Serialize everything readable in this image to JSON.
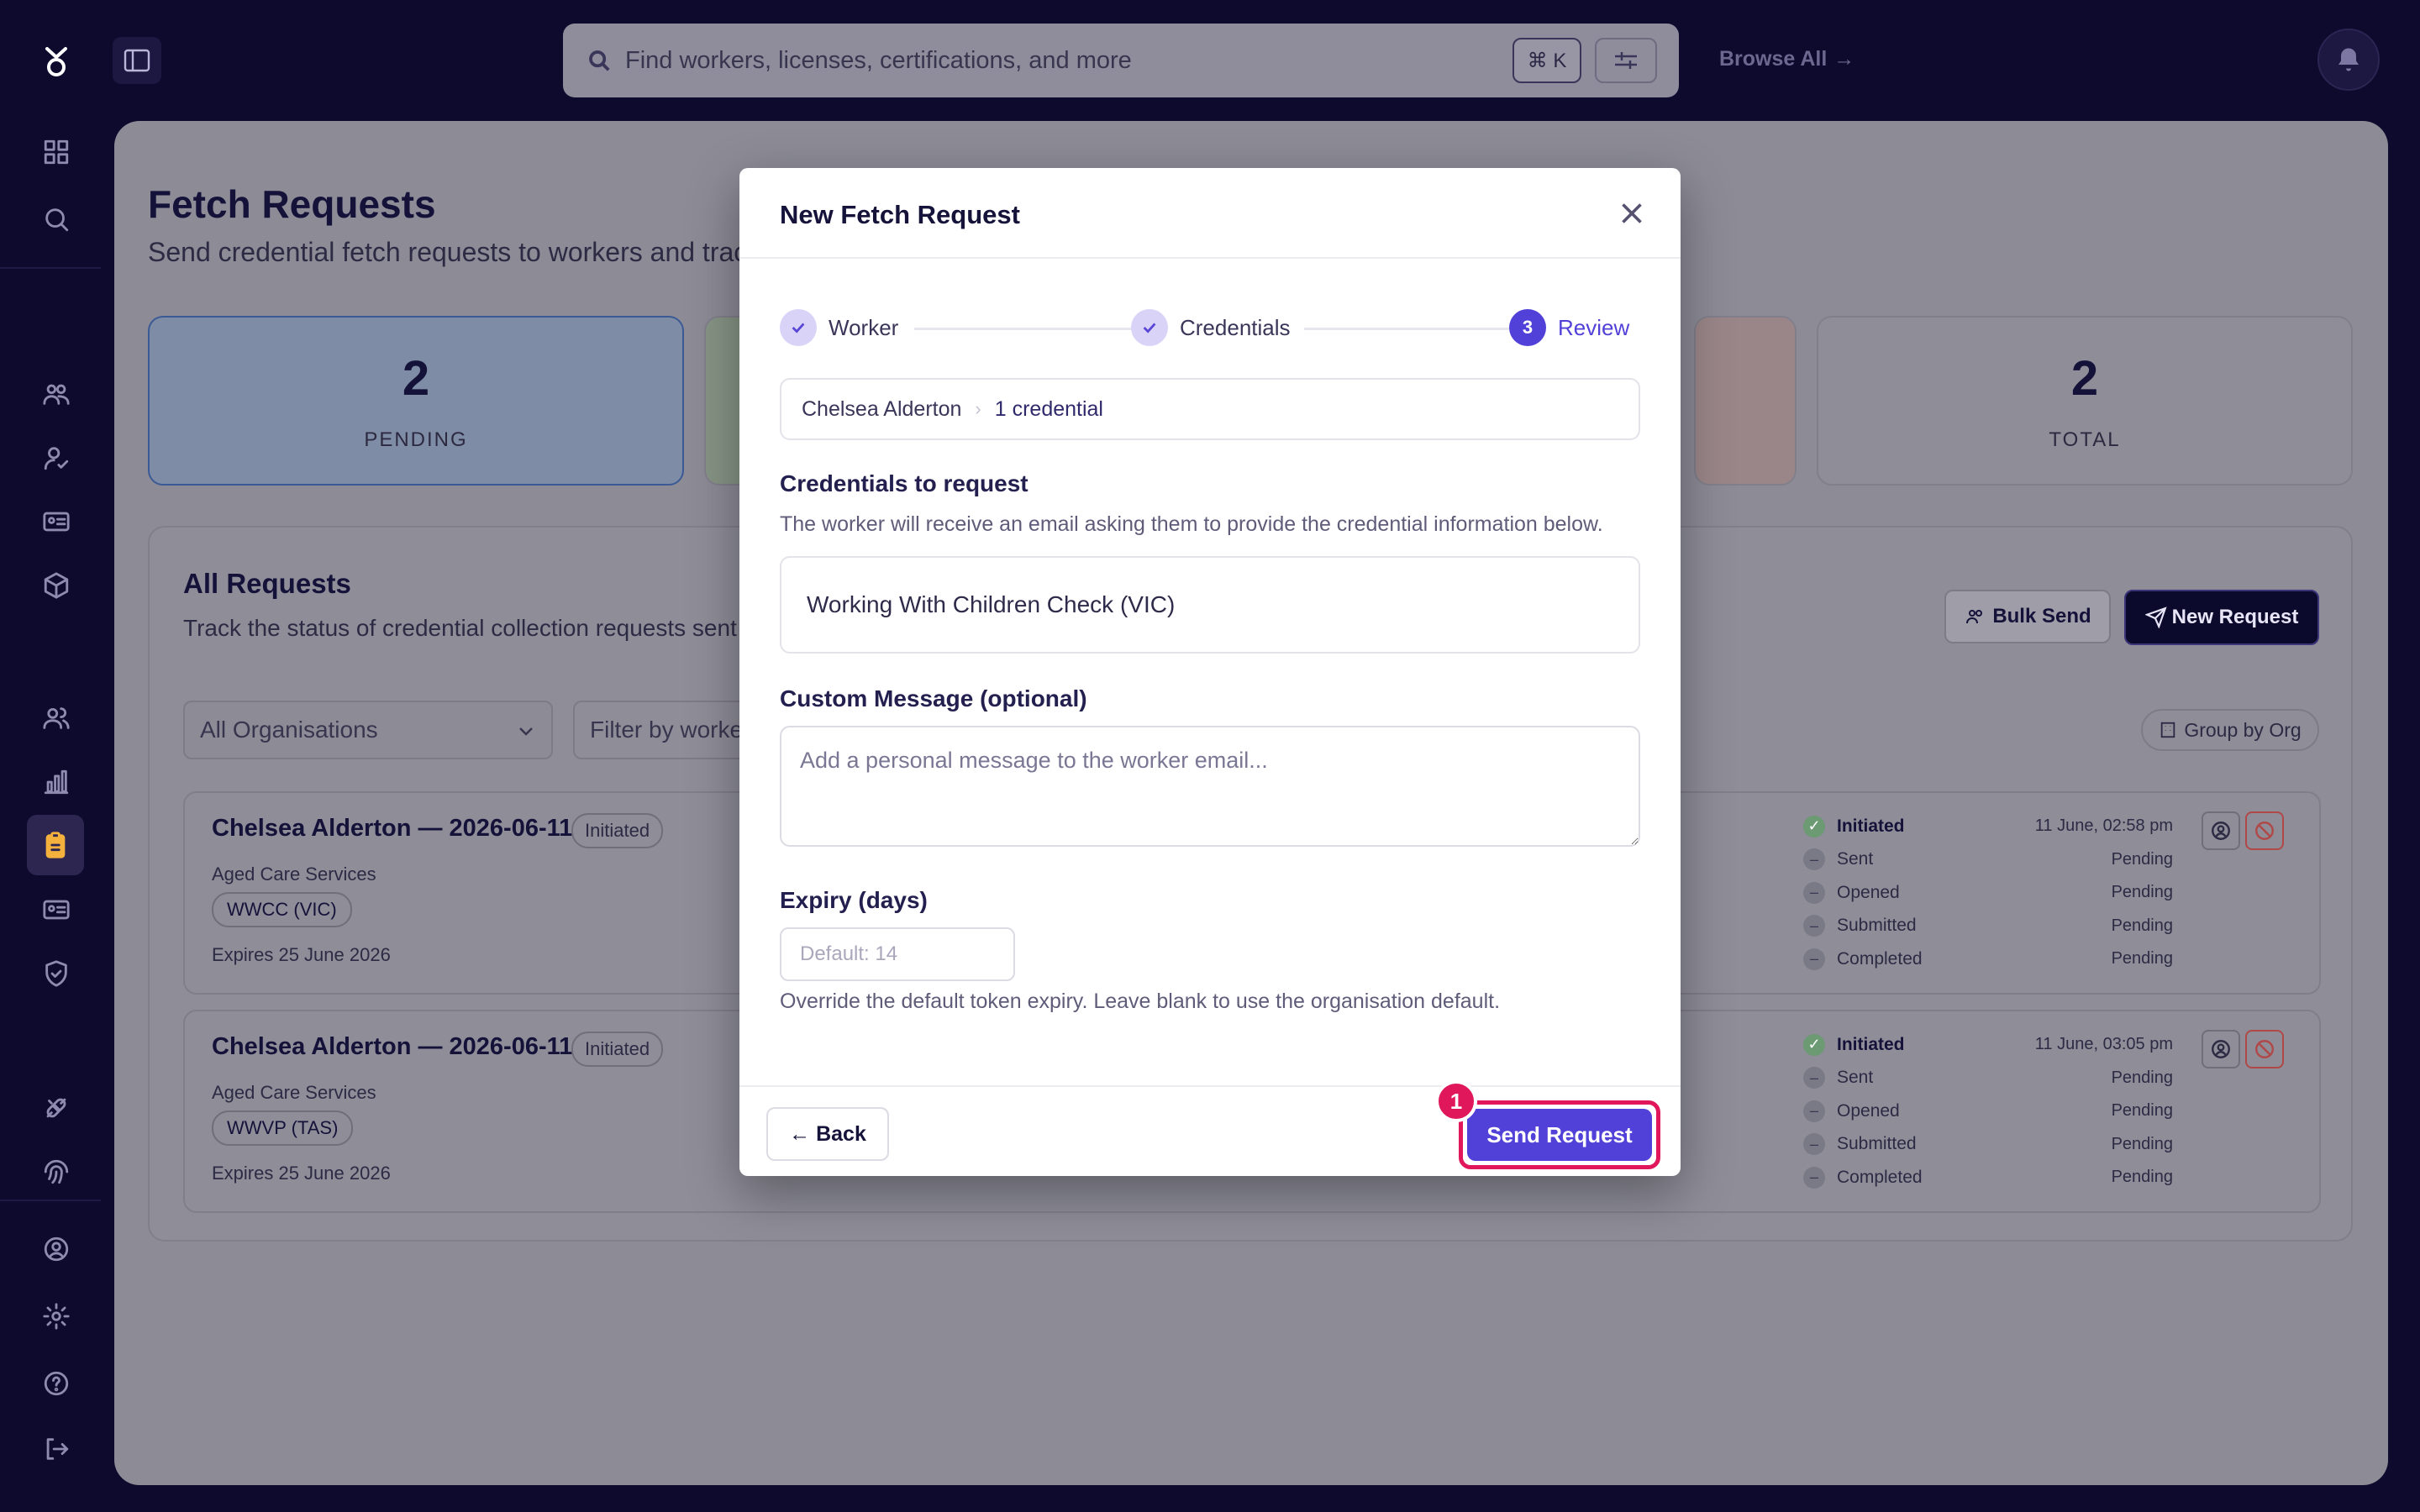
{
  "topbar": {
    "search_placeholder": "Find workers, licenses, certifications, and more",
    "shortcut": "⌘ K",
    "browse_all": "Browse All",
    "browse_arrow": "→"
  },
  "page": {
    "title": "Fetch Requests",
    "subtitle": "Send credential fetch requests to workers and trac"
  },
  "stats": [
    {
      "value": "2",
      "label": "PENDING"
    },
    {
      "value": "2",
      "label": "TOTAL"
    }
  ],
  "requests_card": {
    "title": "All Requests",
    "subtitle": "Track the status of credential collection requests sent t",
    "bulk_send": "Bulk Send",
    "new_request": "New Request",
    "org_filter": "All Organisations",
    "worker_filter": "Filter by worke",
    "group_by": "Group by Org"
  },
  "requests": [
    {
      "title": "Chelsea Alderton — 2026-06-11",
      "status": "Initiated",
      "org": "Aged Care Services",
      "tag": "WWCC (VIC)",
      "expires": "Expires 25 June 2026",
      "timeline": [
        {
          "step": "Initiated",
          "when": "11 June, 02:58 pm",
          "done": true
        },
        {
          "step": "Sent",
          "when": "Pending",
          "done": false
        },
        {
          "step": "Opened",
          "when": "Pending",
          "done": false
        },
        {
          "step": "Submitted",
          "when": "Pending",
          "done": false
        },
        {
          "step": "Completed",
          "when": "Pending",
          "done": false
        }
      ]
    },
    {
      "title": "Chelsea Alderton — 2026-06-11",
      "status": "Initiated",
      "org": "Aged Care Services",
      "tag": "WWVP (TAS)",
      "expires": "Expires 25 June 2026",
      "timeline": [
        {
          "step": "Initiated",
          "when": "11 June, 03:05 pm",
          "done": true
        },
        {
          "step": "Sent",
          "when": "Pending",
          "done": false
        },
        {
          "step": "Opened",
          "when": "Pending",
          "done": false
        },
        {
          "step": "Submitted",
          "when": "Pending",
          "done": false
        },
        {
          "step": "Completed",
          "when": "Pending",
          "done": false
        }
      ]
    }
  ],
  "modal": {
    "title": "New Fetch Request",
    "steps": [
      {
        "label": "Worker",
        "state": "done"
      },
      {
        "label": "Credentials",
        "state": "done"
      },
      {
        "label": "Review",
        "state": "active",
        "number": "3"
      }
    ],
    "summary_worker": "Chelsea Alderton",
    "summary_sep": "›",
    "summary_count": "1 credential",
    "credentials_title": "Credentials to request",
    "credentials_desc": "The worker will receive an email asking them to provide the credential information below.",
    "credential_item": "Working With Children Check (VIC)",
    "message_title": "Custom Message (optional)",
    "message_placeholder": "Add a personal message to the worker email...",
    "expiry_title": "Expiry (days)",
    "expiry_placeholder": "Default: 14",
    "expiry_help": "Override the default token expiry. Leave blank to use the organisation default.",
    "back": "← Back",
    "send": "Send Request",
    "marker": "1"
  },
  "colors": {
    "accent": "#5141d8",
    "highlight": "#e0175a",
    "background": "#0e0a2e"
  }
}
